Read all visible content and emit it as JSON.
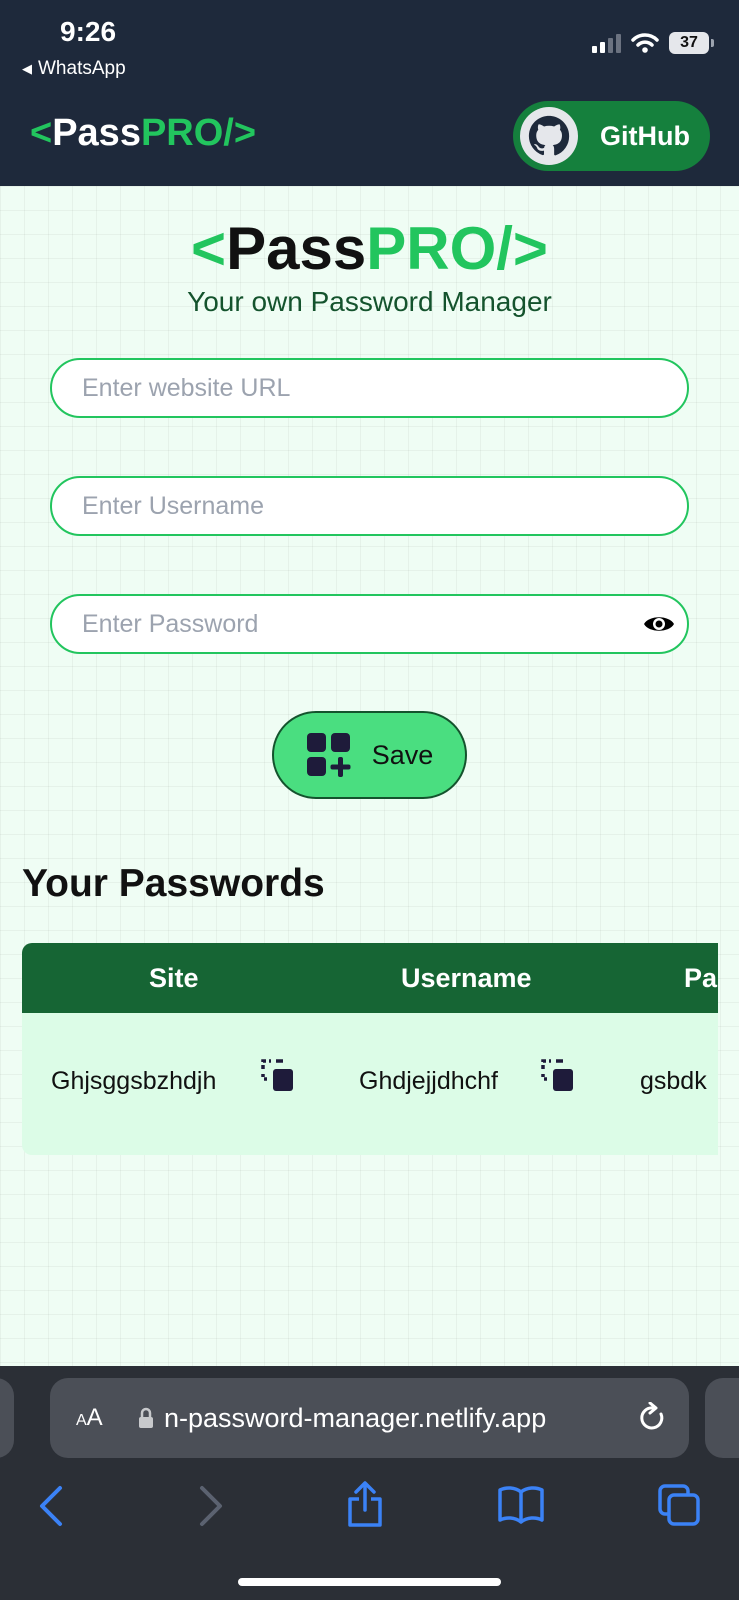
{
  "status_bar": {
    "time": "9:26",
    "back_app": "WhatsApp",
    "battery": "37"
  },
  "nav": {
    "logo_open": "<",
    "logo_pass": "Pass",
    "logo_pro": "PRO/>",
    "github_label": "GitHub"
  },
  "hero": {
    "logo_open": "<",
    "logo_pass": "Pass",
    "logo_pro": "PRO/>",
    "tagline": "Your own Password Manager"
  },
  "form": {
    "url_placeholder": "Enter website URL",
    "username_placeholder": "Enter Username",
    "password_placeholder": "Enter Password",
    "save_label": "Save"
  },
  "passwords": {
    "title": "Your Passwords",
    "columns": [
      "Site",
      "Username",
      "Pa"
    ],
    "rows": [
      {
        "site": "Ghjsggsbzhdjh",
        "username": "Ghdjejjdhchf",
        "password": "gsbdk"
      }
    ]
  },
  "browser": {
    "aa_small": "A",
    "aa_large": "A",
    "url": "n-password-manager.netlify.app"
  },
  "colors": {
    "brand_green": "#22c55e",
    "header_bg": "#1e293b",
    "table_header": "#166534",
    "table_row": "#dcfce7",
    "save_button": "#4ade80"
  }
}
